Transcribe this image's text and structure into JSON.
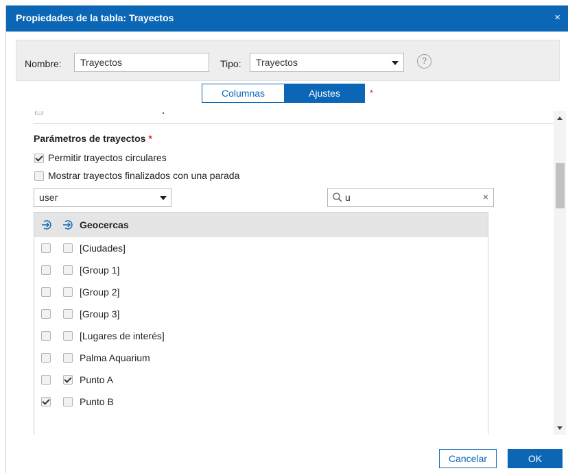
{
  "dialog": {
    "title": "Propiedades de la tabla: Trayectos",
    "close_glyph": "×"
  },
  "header": {
    "name_label": "Nombre:",
    "name_value": "Trayectos",
    "type_label": "Tipo:",
    "type_value": "Trayectos",
    "help_glyph": "?"
  },
  "tabs": [
    {
      "label": "Columnas",
      "active": false
    },
    {
      "label": "Ajustes",
      "active": true
    }
  ],
  "required_mark": "*",
  "section": {
    "title": "Parámetros de trayectos",
    "options": [
      {
        "label": "Permitir trayectos circulares",
        "checked": true
      },
      {
        "label": "Mostrar trayectos finalizados con una parada",
        "checked": false
      }
    ]
  },
  "filter": {
    "user_select": "user",
    "search_value": "u",
    "clear_glyph": "×"
  },
  "list": {
    "header": "Geocercas",
    "rows": [
      {
        "label": "[Ciudades]",
        "col1": false,
        "col2": false
      },
      {
        "label": "[Group 1]",
        "col1": false,
        "col2": false
      },
      {
        "label": "[Group 2]",
        "col1": false,
        "col2": false
      },
      {
        "label": "[Group 3]",
        "col1": false,
        "col2": false
      },
      {
        "label": "[Lugares de interés]",
        "col1": false,
        "col2": false
      },
      {
        "label": "Palma Aquarium",
        "col1": false,
        "col2": false
      },
      {
        "label": "Punto A",
        "col1": false,
        "col2": true
      },
      {
        "label": "Punto B",
        "col1": true,
        "col2": false
      }
    ]
  },
  "footer": {
    "cancel_label": "Cancelar",
    "ok_label": "OK"
  },
  "colors": {
    "accent": "#0b67b6",
    "required": "#e0251b"
  }
}
